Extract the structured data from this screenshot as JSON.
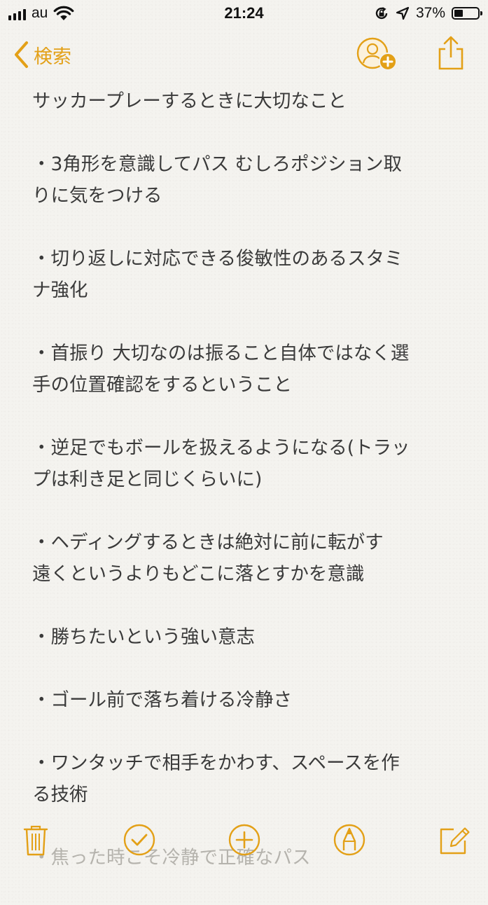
{
  "status_bar": {
    "carrier": "au",
    "time": "21:24",
    "battery_percent": "37%",
    "battery_level": 0.37
  },
  "nav": {
    "back_label": "検索"
  },
  "note": {
    "title": "サッカープレーするときに大切なこと",
    "items": [
      [
        "・3角形を意識してパス むしろポジション取",
        "りに気をつける"
      ],
      [
        "・切り返しに対応できる俊敏性のあるスタミ",
        "ナ強化"
      ],
      [
        "・首振り 大切なのは振ること自体ではなく選",
        "手の位置確認をするということ"
      ],
      [
        "・逆足でもボールを扱えるようになる(トラッ",
        "プは利き足と同じくらいに)"
      ],
      [
        "・ヘディングするときは絶対に前に転がす",
        "遠くというよりもどこに落とすかを意識"
      ],
      [
        "・勝ちたいという強い意志"
      ],
      [
        "・ゴール前で落ち着ける冷静さ"
      ],
      [
        "・ワンタッチで相手をかわす、スペースを作",
        "る技術"
      ],
      [
        "・焦った時こそ冷静で正確なパス"
      ]
    ]
  },
  "colors": {
    "accent": "#e3a017",
    "text": "#3a3a3a",
    "background": "#f4f3ef"
  },
  "icons": {
    "back": "chevron-left-icon",
    "add_person": "add-person-icon",
    "share": "share-icon",
    "trash": "trash-icon",
    "checklist": "checklist-icon",
    "add": "plus-circle-icon",
    "markup": "markup-pen-icon",
    "compose": "compose-icon"
  }
}
